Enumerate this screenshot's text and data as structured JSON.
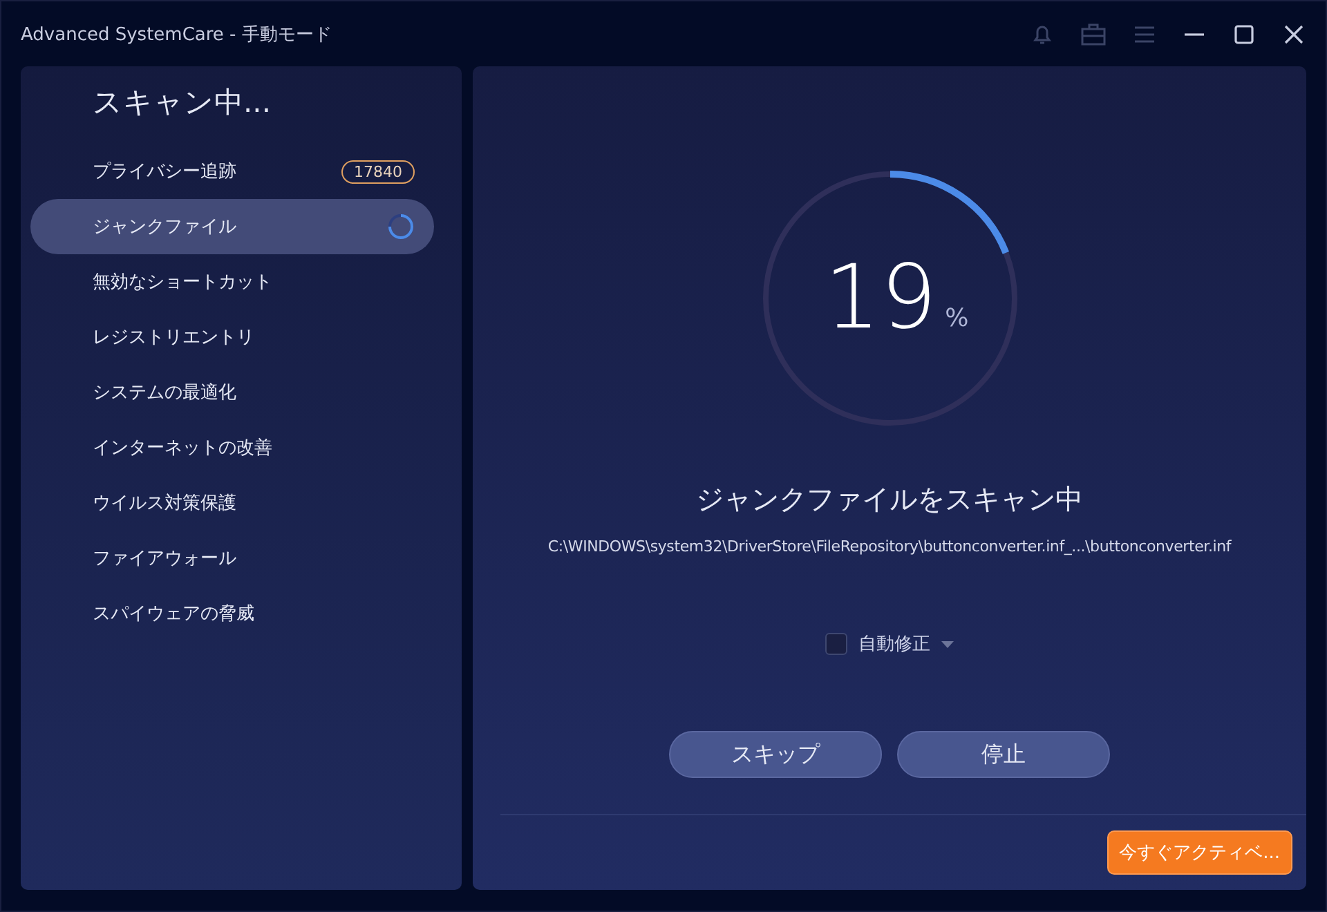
{
  "window": {
    "title": "Advanced SystemCare - 手動モード"
  },
  "sidebar": {
    "heading": "スキャン中...",
    "items": [
      {
        "label": "プライバシー追跡",
        "selected": false,
        "badge": "17840",
        "scanning": false
      },
      {
        "label": "ジャンクファイル",
        "selected": true,
        "scanning": true
      },
      {
        "label": "無効なショートカット",
        "selected": false,
        "scanning": false
      },
      {
        "label": "レジストリエントリ",
        "selected": false,
        "scanning": false
      },
      {
        "label": "システムの最適化",
        "selected": false,
        "scanning": false
      },
      {
        "label": "インターネットの改善",
        "selected": false,
        "scanning": false
      },
      {
        "label": "ウイルス対策保護",
        "selected": false,
        "scanning": false
      },
      {
        "label": "ファイアウォール",
        "selected": false,
        "scanning": false
      },
      {
        "label": "スパイウェアの脅威",
        "selected": false,
        "scanning": false
      }
    ]
  },
  "progress": {
    "level": 0.19,
    "reading": "19",
    "unit": "%"
  },
  "status": {
    "title": "ジャンクファイルをスキャン中",
    "path": "C:\\WINDOWS\\system32\\DriverStore\\FileRepository\\buttonconverter.inf_...\\buttonconverter.inf"
  },
  "auto_fix": {
    "label": "自動修正",
    "checked": false
  },
  "buttons": [
    "スキップ",
    "停止"
  ],
  "activate_button": "今すぐアクティベ..."
}
